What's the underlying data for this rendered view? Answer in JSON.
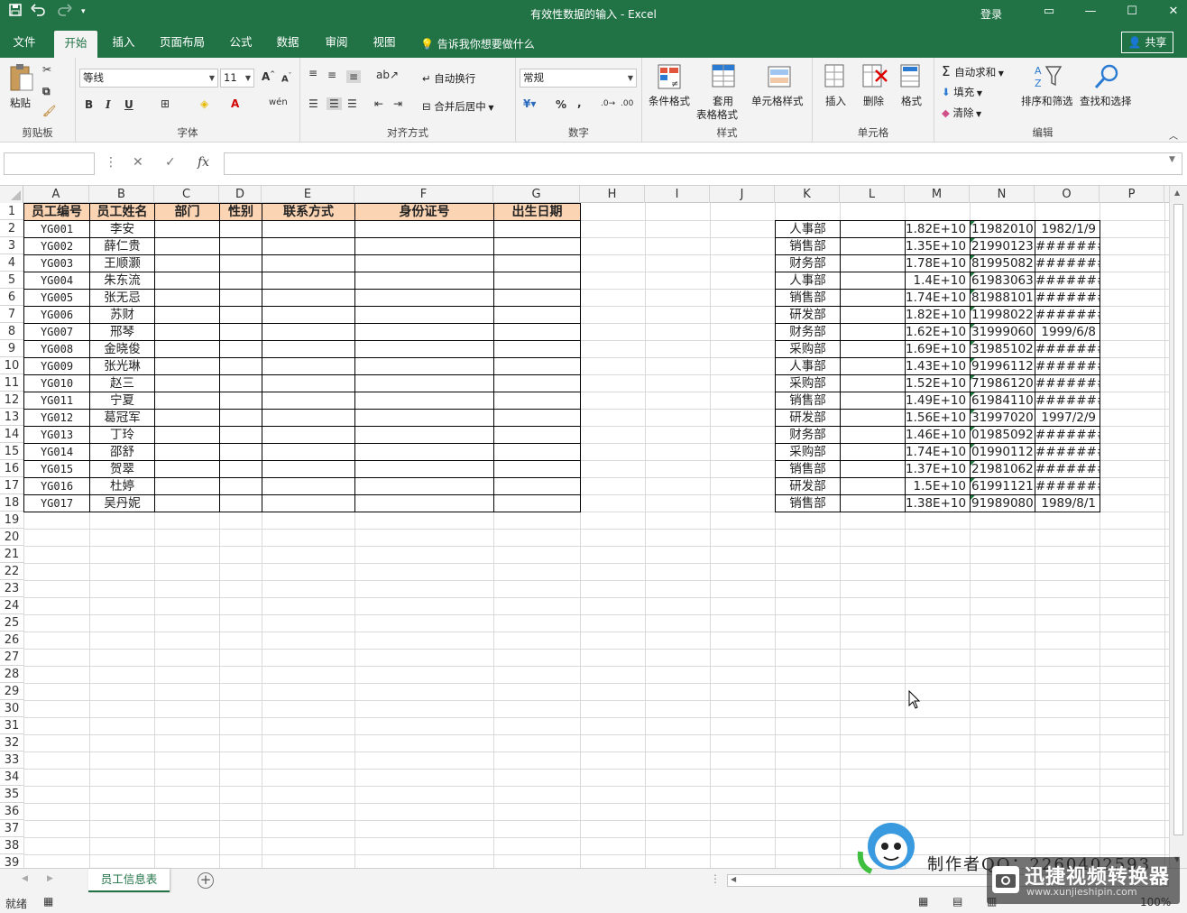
{
  "window": {
    "title": "有效性数据的输入  -  Excel",
    "login": "登录",
    "qat": [
      "save-icon",
      "undo-icon",
      "redo-icon",
      "customize-icon"
    ],
    "accent": "#217346"
  },
  "menu": {
    "tabs": [
      "文件",
      "开始",
      "插入",
      "页面布局",
      "公式",
      "数据",
      "审阅",
      "视图"
    ],
    "active": "开始",
    "tell_me": "告诉我你想要做什么",
    "share": "共享"
  },
  "ribbon": {
    "clipboard": {
      "paste": "粘贴",
      "label": "剪贴板"
    },
    "font": {
      "name": "等线",
      "size": "11",
      "label": "字体",
      "bold": "B",
      "italic": "I",
      "underline": "U"
    },
    "alignment": {
      "wrap": "自动换行",
      "merge": "合并后居中",
      "label": "对齐方式"
    },
    "number": {
      "format": "常规",
      "percent": "%",
      "comma": ",",
      "label": "数字"
    },
    "styles": {
      "conditional": "条件格式",
      "table1": "套用",
      "table2": "表格格式",
      "cell_styles": "单元格样式",
      "label": "样式"
    },
    "cells": {
      "insert": "插入",
      "delete": "删除",
      "format": "格式",
      "label": "单元格"
    },
    "editing": {
      "autosum": "自动求和",
      "fill": "填充",
      "clear": "清除",
      "sort": "排序和筛选",
      "find": "查找和选择",
      "label": "编辑"
    }
  },
  "formula_bar": {
    "name_box": "",
    "fx": "fx",
    "formula": ""
  },
  "columns": [
    "A",
    "B",
    "C",
    "D",
    "E",
    "F",
    "G",
    "H",
    "I",
    "J",
    "K",
    "L",
    "M",
    "N",
    "O",
    "P"
  ],
  "rows": [
    "1",
    "2",
    "3",
    "4",
    "5",
    "6",
    "7",
    "8",
    "9",
    "10",
    "11",
    "12",
    "13",
    "14",
    "15",
    "16",
    "17",
    "18",
    "19",
    "20",
    "21",
    "22",
    "23",
    "24",
    "25",
    "26",
    "27",
    "28",
    "29",
    "30",
    "31",
    "32",
    "33",
    "34",
    "35",
    "36",
    "37",
    "38",
    "39"
  ],
  "table": {
    "headers": [
      "员工编号",
      "员工姓名",
      "部门",
      "性别",
      "联系方式",
      "身份证号",
      "出生日期"
    ],
    "header_color": "#fbd4b4",
    "rows": [
      [
        "YG001",
        "李安"
      ],
      [
        "YG002",
        "薛仁贵"
      ],
      [
        "YG003",
        "王顺灏"
      ],
      [
        "YG004",
        "朱东流"
      ],
      [
        "YG005",
        "张无忌"
      ],
      [
        "YG006",
        "苏财"
      ],
      [
        "YG007",
        "邢琴"
      ],
      [
        "YG008",
        "金晓俊"
      ],
      [
        "YG009",
        "张光琳"
      ],
      [
        "YG010",
        "赵三"
      ],
      [
        "YG011",
        "宁夏"
      ],
      [
        "YG012",
        "葛冠军"
      ],
      [
        "YG013",
        "丁玲"
      ],
      [
        "YG014",
        "邵舒"
      ],
      [
        "YG015",
        "贺翠"
      ],
      [
        "YG016",
        "杜婷"
      ],
      [
        "YG017",
        "吴丹妮"
      ]
    ]
  },
  "side_table": {
    "rows": [
      [
        "人事部",
        "1.82E+10",
        "11982010",
        "1982/1/9"
      ],
      [
        "销售部",
        "1.35E+10",
        "21990123",
        "#######"
      ],
      [
        "财务部",
        "1.78E+10",
        "81995082",
        "#######"
      ],
      [
        "人事部",
        "1.4E+10",
        "61983063",
        "#######"
      ],
      [
        "销售部",
        "1.74E+10",
        "81988101",
        "#######"
      ],
      [
        "研发部",
        "1.82E+10",
        "11998022",
        "#######"
      ],
      [
        "财务部",
        "1.62E+10",
        "31999060",
        "1999/6/8"
      ],
      [
        "采购部",
        "1.69E+10",
        "31985102",
        "#######"
      ],
      [
        "人事部",
        "1.43E+10",
        "91996112",
        "#######"
      ],
      [
        "采购部",
        "1.52E+10",
        "71986120",
        "#######"
      ],
      [
        "销售部",
        "1.49E+10",
        "61984110",
        "#######"
      ],
      [
        "研发部",
        "1.56E+10",
        "31997020",
        "1997/2/9"
      ],
      [
        "财务部",
        "1.46E+10",
        "01985092",
        "#######"
      ],
      [
        "采购部",
        "1.74E+10",
        "01990112",
        "#######"
      ],
      [
        "销售部",
        "1.37E+10",
        "21981062",
        "#######"
      ],
      [
        "研发部",
        "1.5E+10",
        "61991121",
        "#######"
      ],
      [
        "销售部",
        "1.38E+10",
        "91989080",
        "1989/8/1"
      ]
    ]
  },
  "sheet": {
    "tab": "员工信息表",
    "status": "就绪",
    "zoom": "100%"
  },
  "watermark": {
    "text": "制作者QQ：2260402593",
    "brand": "迅捷视频转换器",
    "url": "www.xunjieshipin.com"
  }
}
